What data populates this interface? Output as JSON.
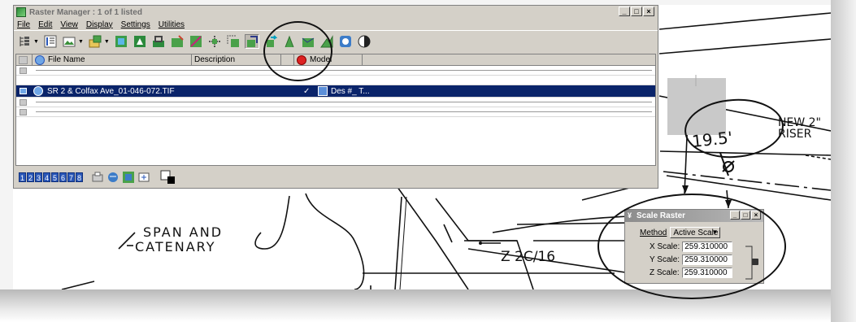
{
  "raster_manager": {
    "title": "Raster Manager : 1 of 1 listed",
    "menu": [
      "File",
      "Edit",
      "View",
      "Display",
      "Settings",
      "Utilities"
    ],
    "columns": {
      "file_name": "File Name",
      "description": "Description",
      "model": "Model"
    },
    "rows": [
      {
        "file_name": "",
        "check": "",
        "model": ""
      },
      {
        "file_name": "SR 2 & Colfax Ave_01-046-072.TIF",
        "check": "✓",
        "model": "Des #_ T..."
      },
      {
        "file_name": "",
        "check": "",
        "model": ""
      },
      {
        "file_name": "",
        "check": "",
        "model": ""
      }
    ],
    "views": [
      "1",
      "2",
      "3",
      "4",
      "5",
      "6",
      "7",
      "8"
    ]
  },
  "scale_raster": {
    "title": "Scale Raster",
    "method_label": "Method",
    "method_value": "Active Scale",
    "x_label": "X Scale:",
    "y_label": "Y Scale:",
    "z_label": "Z Scale:",
    "x_value": "259.310000",
    "y_value": "259.310000",
    "z_value": "259.310000"
  },
  "drawing": {
    "label_dimension": "19.5'",
    "label_new": "NEW 2\"",
    "label_riser": "RISER",
    "label_span": "SPAN AND",
    "label_catenary": "CATENARY",
    "label_z": "Z 2C/16"
  },
  "colors": {
    "selection": "#0a246a",
    "window_face": "#d4d0c8",
    "view_button": "#2a57b8"
  }
}
